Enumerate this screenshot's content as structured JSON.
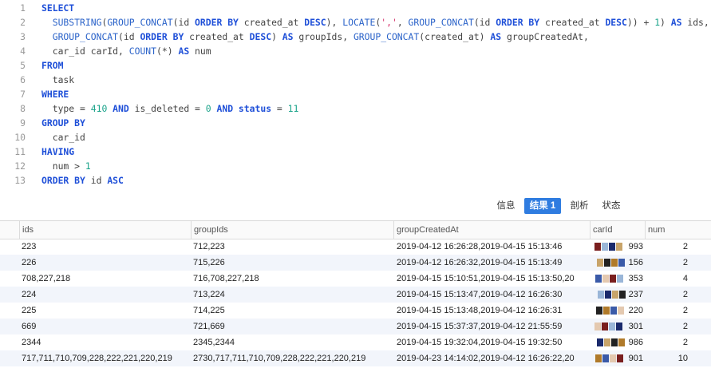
{
  "editor": {
    "lines": [
      {
        "n": "1",
        "tokens": [
          {
            "t": "SELECT",
            "c": "kw"
          }
        ]
      },
      {
        "n": "2",
        "tokens": [
          {
            "t": "  "
          },
          {
            "t": "SUBSTRING",
            "c": "fn"
          },
          {
            "t": "("
          },
          {
            "t": "GROUP_CONCAT",
            "c": "fn"
          },
          {
            "t": "(id "
          },
          {
            "t": "ORDER BY",
            "c": "kw"
          },
          {
            "t": " created_at "
          },
          {
            "t": "DESC",
            "c": "kw"
          },
          {
            "t": "), "
          },
          {
            "t": "LOCATE",
            "c": "fn"
          },
          {
            "t": "("
          },
          {
            "t": "','",
            "c": "str"
          },
          {
            "t": ", "
          },
          {
            "t": "GROUP_CONCAT",
            "c": "fn"
          },
          {
            "t": "(id "
          },
          {
            "t": "ORDER BY",
            "c": "kw"
          },
          {
            "t": " created_at "
          },
          {
            "t": "DESC",
            "c": "kw"
          },
          {
            "t": ")) + "
          },
          {
            "t": "1",
            "c": "num"
          },
          {
            "t": ") "
          },
          {
            "t": "AS",
            "c": "kw"
          },
          {
            "t": " ids,"
          }
        ]
      },
      {
        "n": "3",
        "tokens": [
          {
            "t": "  "
          },
          {
            "t": "GROUP_CONCAT",
            "c": "fn"
          },
          {
            "t": "(id "
          },
          {
            "t": "ORDER BY",
            "c": "kw"
          },
          {
            "t": " created_at "
          },
          {
            "t": "DESC",
            "c": "kw"
          },
          {
            "t": ") "
          },
          {
            "t": "AS",
            "c": "kw"
          },
          {
            "t": " groupIds, "
          },
          {
            "t": "GROUP_CONCAT",
            "c": "fn"
          },
          {
            "t": "(created_at) "
          },
          {
            "t": "AS",
            "c": "kw"
          },
          {
            "t": " groupCreatedAt,"
          }
        ]
      },
      {
        "n": "4",
        "tokens": [
          {
            "t": "  car_id carId, "
          },
          {
            "t": "COUNT",
            "c": "fn"
          },
          {
            "t": "(*) "
          },
          {
            "t": "AS",
            "c": "kw"
          },
          {
            "t": " num"
          }
        ]
      },
      {
        "n": "5",
        "tokens": [
          {
            "t": "FROM",
            "c": "kw"
          }
        ]
      },
      {
        "n": "6",
        "tokens": [
          {
            "t": "  task"
          }
        ]
      },
      {
        "n": "7",
        "tokens": [
          {
            "t": "WHERE",
            "c": "kw"
          }
        ]
      },
      {
        "n": "8",
        "tokens": [
          {
            "t": "  type = "
          },
          {
            "t": "410",
            "c": "num"
          },
          {
            "t": " "
          },
          {
            "t": "AND",
            "c": "kw"
          },
          {
            "t": " is_deleted = "
          },
          {
            "t": "0",
            "c": "num"
          },
          {
            "t": " "
          },
          {
            "t": "AND",
            "c": "kw"
          },
          {
            "t": " "
          },
          {
            "t": "status",
            "c": "kw"
          },
          {
            "t": " = "
          },
          {
            "t": "11",
            "c": "num"
          }
        ]
      },
      {
        "n": "9",
        "tokens": [
          {
            "t": "GROUP BY",
            "c": "kw"
          }
        ]
      },
      {
        "n": "10",
        "tokens": [
          {
            "t": "  car_id"
          }
        ]
      },
      {
        "n": "11",
        "tokens": [
          {
            "t": "HAVING",
            "c": "kw"
          }
        ]
      },
      {
        "n": "12",
        "tokens": [
          {
            "t": "  num > "
          },
          {
            "t": "1",
            "c": "num"
          }
        ]
      },
      {
        "n": "13",
        "tokens": [
          {
            "t": "ORDER BY",
            "c": "kw"
          },
          {
            "t": " id "
          },
          {
            "t": "ASC",
            "c": "kw"
          }
        ]
      }
    ]
  },
  "tabs": [
    {
      "label": "信息",
      "active": false
    },
    {
      "label": "结果 1",
      "active": true
    },
    {
      "label": "剖析",
      "active": false
    },
    {
      "label": "状态",
      "active": false
    }
  ],
  "table": {
    "columns": [
      "ids",
      "groupIds",
      "groupCreatedAt",
      "carId",
      "num"
    ],
    "rows": [
      {
        "ids": "223",
        "groupIds": "712,223",
        "created": "2019-04-12 16:26:28,2019-04-15 15:13:46",
        "carId": "993",
        "num": "2"
      },
      {
        "ids": "226",
        "groupIds": "715,226",
        "created": "2019-04-12 16:26:32,2019-04-15 15:13:49",
        "carId": "156",
        "num": "2"
      },
      {
        "ids": "708,227,218",
        "groupIds": "716,708,227,218",
        "created": "2019-04-15 15:10:51,2019-04-15 15:13:50,20",
        "carId": "353",
        "num": "4"
      },
      {
        "ids": "224",
        "groupIds": "713,224",
        "created": "2019-04-15 15:13:47,2019-04-12 16:26:30",
        "carId": "237",
        "num": "2"
      },
      {
        "ids": "225",
        "groupIds": "714,225",
        "created": "2019-04-15 15:13:48,2019-04-12 16:26:31",
        "carId": "220",
        "num": "2"
      },
      {
        "ids": "669",
        "groupIds": "721,669",
        "created": "2019-04-15 15:37:37,2019-04-12 21:55:59",
        "carId": "301",
        "num": "2"
      },
      {
        "ids": "2344",
        "groupIds": "2345,2344",
        "created": "2019-04-15 19:32:04,2019-04-15 19:32:50",
        "carId": "986",
        "num": "2"
      },
      {
        "ids": "717,711,710,709,228,222,221,220,219",
        "groupIds": "2730,717,711,710,709,228,222,221,220,219",
        "created": "2019-04-23 14:14:02,2019-04-12 16:26:22,20",
        "carId": "901",
        "num": "10"
      }
    ]
  },
  "colors": {
    "accent": "#2f7ce0",
    "keyword": "#1e4fd8",
    "number": "#1aa38a",
    "string": "#d6336c"
  }
}
